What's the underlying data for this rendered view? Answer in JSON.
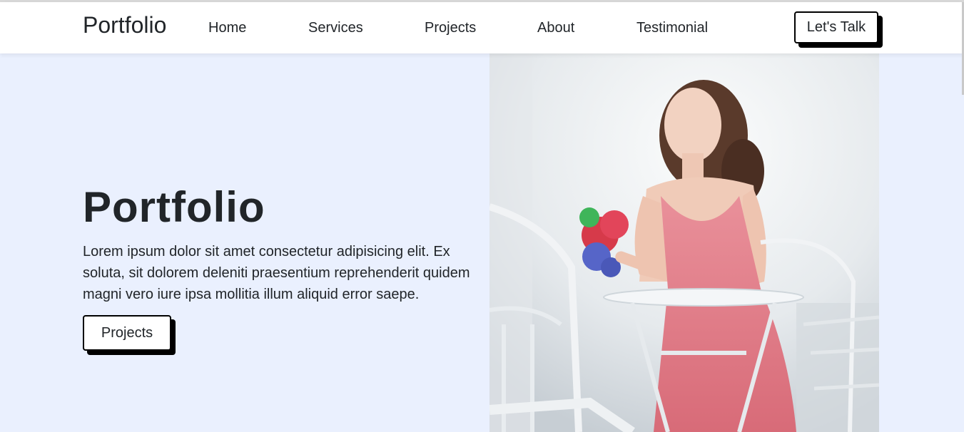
{
  "nav": {
    "brand": "Portfolio",
    "links": [
      "Home",
      "Services",
      "Projects",
      "About",
      "Testimonial"
    ],
    "cta": "Let's Talk"
  },
  "hero": {
    "title": "Portfolio",
    "text": "Lorem ipsum dolor sit amet consectetur adipisicing elit. Ex soluta, sit dolorem deleniti praesentium reprehenderit quidem magni vero iure ipsa mollitia illum aliquid error saepe.",
    "button": "Projects"
  },
  "colors": {
    "background": "#eaf0fe",
    "text": "#212529",
    "button_border": "#000000",
    "dress": "#e07b86"
  }
}
